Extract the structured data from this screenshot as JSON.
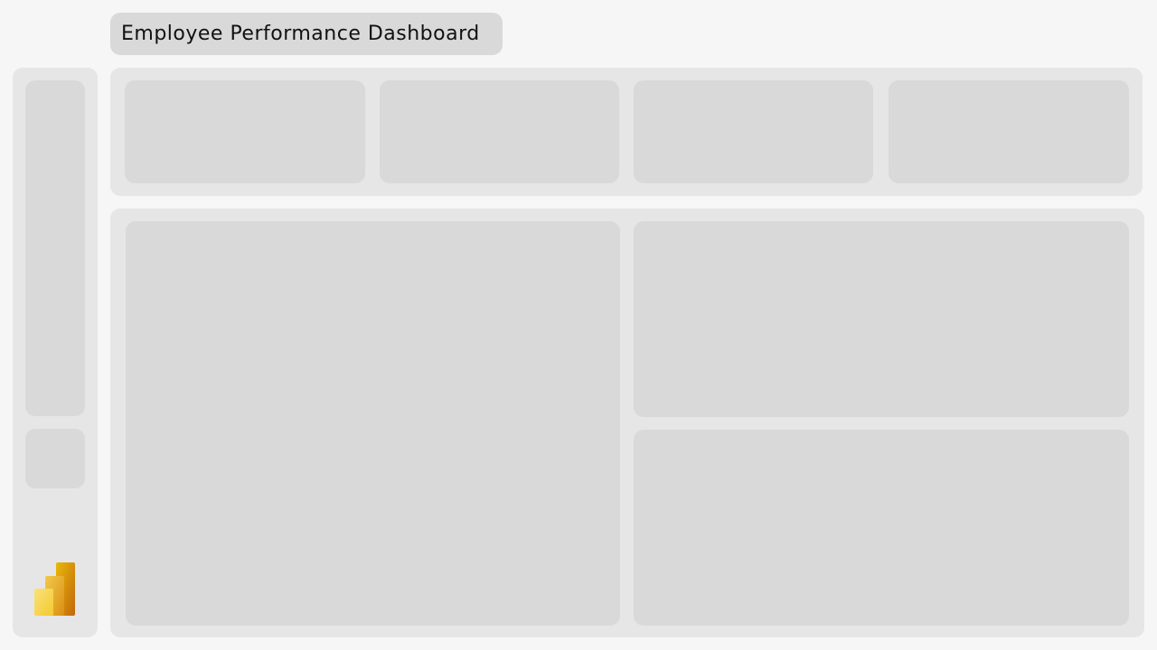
{
  "header": {
    "title": "Employee Performance Dashboard"
  },
  "sidebar": {
    "logo_icon": "power-bi-logo-icon"
  },
  "colors": {
    "background": "#f6f6f6",
    "panel": "#e6e6e6",
    "placeholder": "#d9d9d9",
    "logo_gold": "#e8b90a",
    "logo_yellow": "#f6d94e"
  }
}
